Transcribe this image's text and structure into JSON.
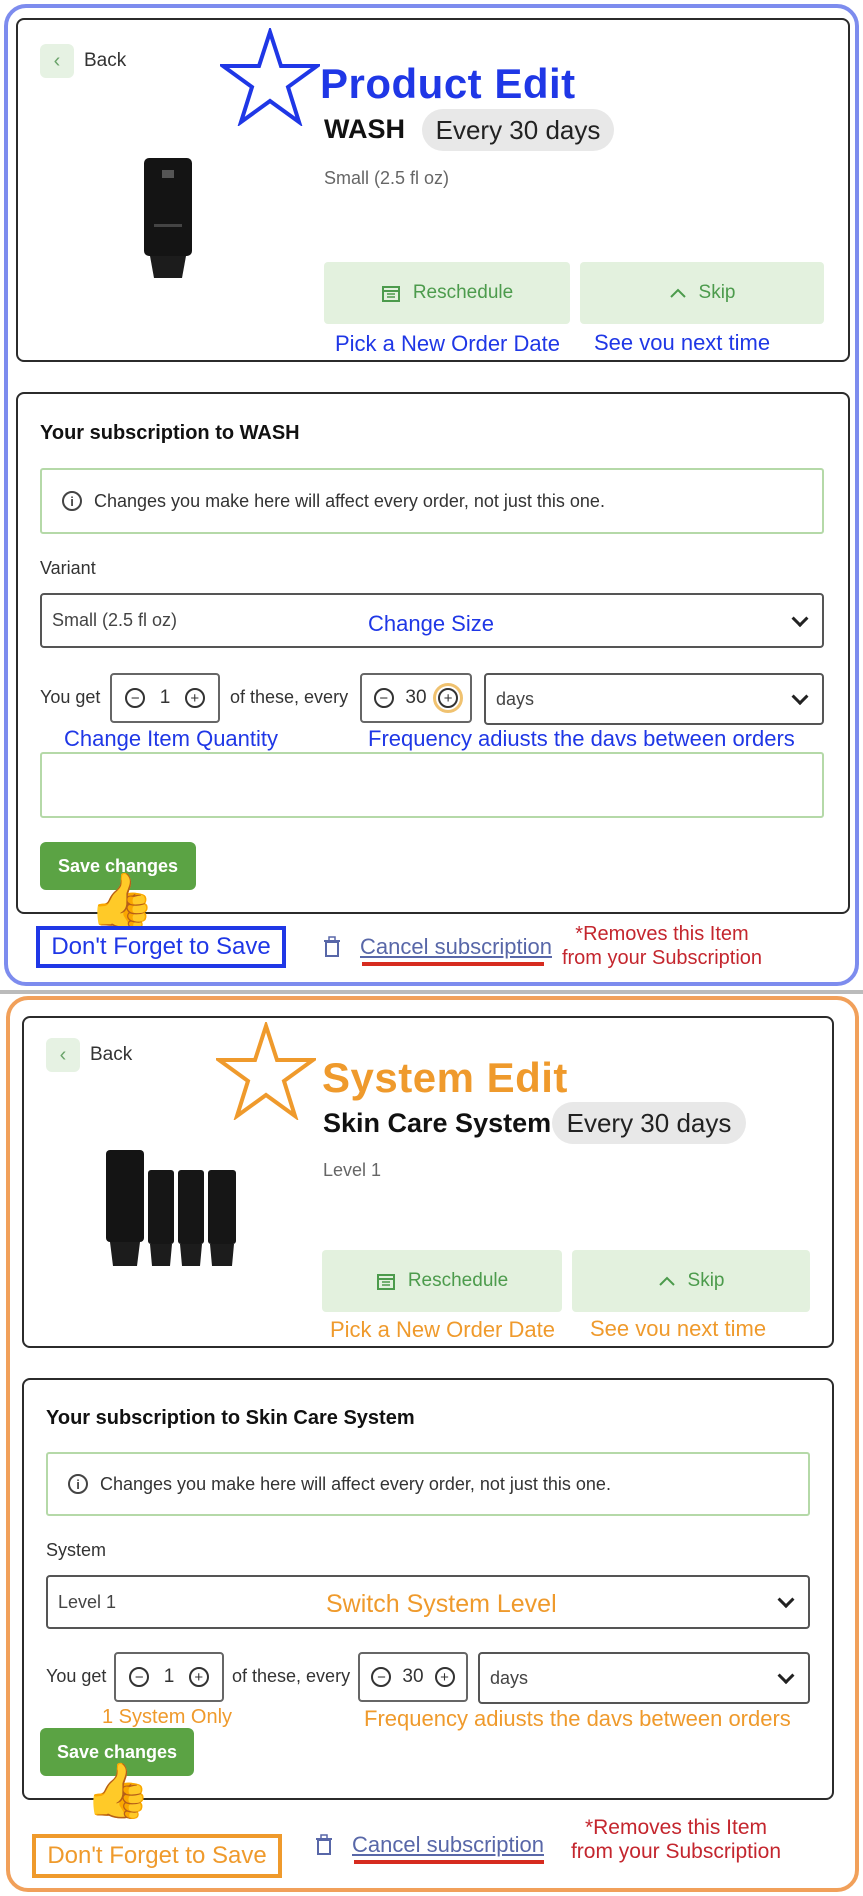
{
  "colors": {
    "blue": "#1f37e6",
    "orange": "#ef9a2c",
    "green": "#5ba344",
    "red": "#d62b1f"
  },
  "product": {
    "back": "Back",
    "heading": "Product Edit",
    "name": "WASH",
    "frequency": "Every 30 days",
    "variant_text": "Small (2.5 fl oz)",
    "reschedule": "Reschedule",
    "skip": "Skip",
    "ann_reschedule": "Pick a New Order Date",
    "ann_skip": "See vou next time",
    "sub_title": "Your subscription to WASH",
    "notice": "Changes you make here will affect every order, not just this one.",
    "variant_label": "Variant",
    "variant_value": "Small (2.5 fl oz)",
    "ann_size": "Change Size",
    "you_get": "You get",
    "qty": "1",
    "of_these": "of these, every",
    "every": "30",
    "unit": "days",
    "ann_qty": "Change Item Quantity",
    "ann_freq": "Frequency adiusts the davs between orders",
    "save": "Save changes",
    "forget": "Don't Forget to Save",
    "cancel": "Cancel subscription",
    "removes1": "*Removes this Item",
    "removes2": "from your Subscription"
  },
  "system": {
    "back": "Back",
    "heading": "System Edit",
    "name": "Skin Care System",
    "frequency": "Every 30 days",
    "level_text": "Level 1",
    "reschedule": "Reschedule",
    "skip": "Skip",
    "ann_reschedule": "Pick a New Order Date",
    "ann_skip": "See vou next time",
    "sub_title": "Your subscription to Skin Care System",
    "notice": "Changes you make here will affect every order, not just this one.",
    "system_label": "System",
    "system_value": "Level 1",
    "ann_level": "Switch System Level",
    "you_get": "You get",
    "qty": "1",
    "of_these": "of these, every",
    "every": "30",
    "unit": "days",
    "ann_qty": "1 System Only",
    "ann_freq": "Frequency adiusts the davs between orders",
    "save": "Save changes",
    "forget": "Don't Forget to Save",
    "cancel": "Cancel subscription",
    "removes1": "*Removes this Item",
    "removes2": "from your Subscription"
  }
}
